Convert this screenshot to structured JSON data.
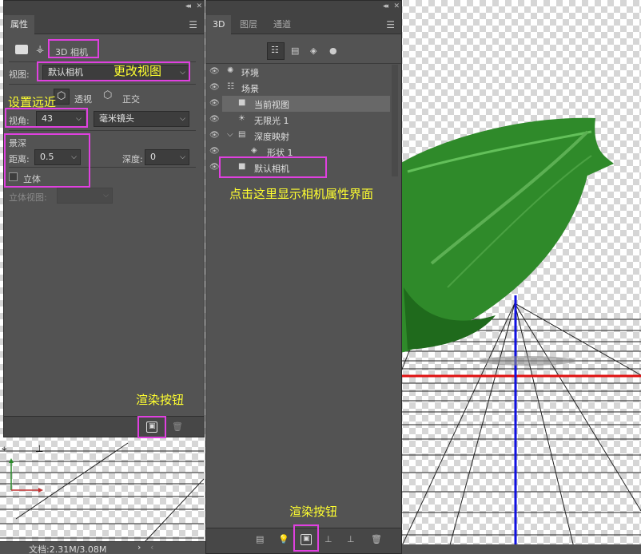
{
  "properties_panel": {
    "tab": "属性",
    "type_label": "3D 相机",
    "view_label": "视图:",
    "view_value": "默认相机",
    "perspective": "透视",
    "orthographic": "正交",
    "fov_label": "视角:",
    "fov_value": "43",
    "lens_value": "毫米镜头",
    "dof_section": "景深",
    "distance_label": "距离:",
    "distance_value": "0.5",
    "depth_label": "深度:",
    "depth_value": "0",
    "stereo_label": "立体",
    "stereo_view_label": "立体视图:"
  },
  "scene_panel": {
    "tabs": [
      "3D",
      "图层",
      "通道"
    ],
    "items": [
      "环境",
      "场景",
      "当前视图",
      "无限光 1",
      "深度映射",
      "形状 1",
      "默认相机"
    ]
  },
  "annotations": {
    "change_view": "更改视图",
    "set_far_near": "设置远近",
    "click_hint": "点击这里显示相机属性界面",
    "render_left": "渲染按钮",
    "render_right": "渲染按钮"
  },
  "status_bar": {
    "doc_info": "文档:2.31M/3.08M"
  },
  "colors": {
    "panel_bg": "#535353",
    "highlight": "#e040e0",
    "annotation": "#ffff30",
    "axis_red": "#e01010",
    "axis_blue": "#1010e0"
  }
}
